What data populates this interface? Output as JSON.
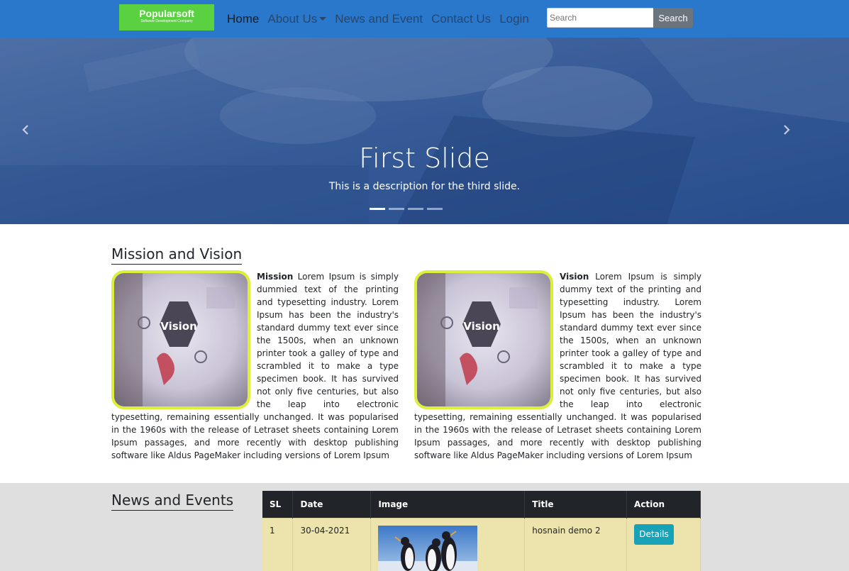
{
  "navbar": {
    "logo_main": "Popularsoft",
    "logo_sub": "Software Development Company",
    "links": [
      "Home",
      "About Us",
      "News and Event",
      "Contact Us",
      "Login"
    ],
    "search_placeholder": "Search",
    "search_button": "Search",
    "bg_color": "#2a78cc",
    "logo_color": "#5ad141"
  },
  "carousel": {
    "title": "First Slide",
    "description": "This is a description for the third slide.",
    "indicator_count": 4,
    "active_index": 0,
    "prev_icon": "chevron-left-icon",
    "next_icon": "chevron-right-icon"
  },
  "mission_vision": {
    "heading": "Mission and Vision",
    "mission_label": "Mission",
    "mission_text": "Lorem Ipsum is simply dummied text of the printing and typesetting industry. Lorem Ipsum has been the industry's standard dummy text ever since the 1500s, when an unknown printer took a galley of type and scrambled it to make a type specimen book. It has survived not only five centuries, but also the leap into electronic typesetting, remaining essentially unchanged. It was popularised in the 1960s with the release of Letraset sheets containing Lorem Ipsum passages, and more recently with desktop publishing software like Aldus PageMaker including versions of Lorem Ipsum",
    "vision_label": "Vision",
    "vision_text": "Lorem Ipsum is simply dummy text of the printing and typesetting industry. Lorem Ipsum has been the industry's standard dummy text ever since the 1500s, when an unknown printer took a galley of type and scrambled it to make a type specimen book. It has survived not only five centuries, but also the leap into electronic typesetting, remaining essentially unchanged. It was popularised in the 1960s with the release of Letraset sheets containing Lorem Ipsum passages, and more recently with desktop publishing software like Aldus PageMaker including versions of Lorem Ipsum",
    "image_word": "Vision",
    "border_color": "#dcef3a"
  },
  "news": {
    "heading": "News and Events",
    "columns": [
      "SL",
      "Date",
      "Image",
      "Title",
      "Action"
    ],
    "rows": [
      {
        "sl": "1",
        "date": "30-04-2021",
        "title": "hosnain demo 2",
        "action": "Details"
      }
    ],
    "row_color": "#ede4ad",
    "button_color": "#17a2b8"
  }
}
